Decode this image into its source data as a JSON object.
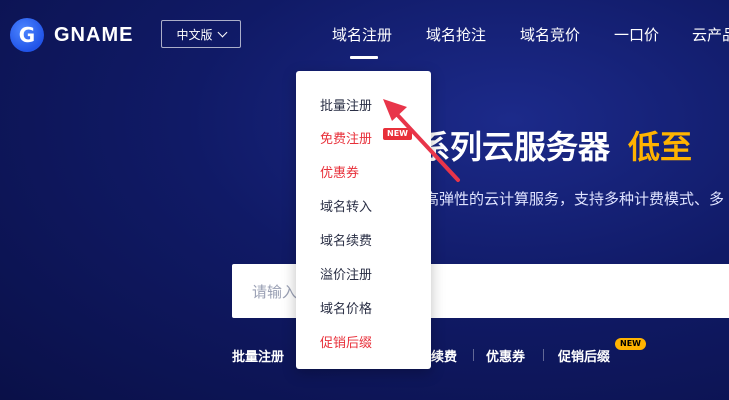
{
  "brand": {
    "logo_glyph": "G",
    "name": "GNAME"
  },
  "language": {
    "label": "中文版"
  },
  "nav": {
    "items": [
      "域名注册",
      "域名抢注",
      "域名竞价",
      "一口价",
      "云产品"
    ]
  },
  "dropdown": {
    "items": [
      {
        "label": "批量注册",
        "highlight": false
      },
      {
        "label": "免费注册",
        "highlight": true,
        "badge": "NEW"
      },
      {
        "label": "优惠券",
        "highlight": true
      },
      {
        "label": "域名转入",
        "highlight": false
      },
      {
        "label": "域名续费",
        "highlight": false
      },
      {
        "label": "溢价注册",
        "highlight": false
      },
      {
        "label": "域名价格",
        "highlight": false
      },
      {
        "label": "促销后缀",
        "highlight": true
      }
    ]
  },
  "hero": {
    "title": "系列云服务器",
    "title_highlight": "低至",
    "subtitle": "高弹性的云计算服务，支持多种计费模式、多"
  },
  "search": {
    "placeholder": "请输入"
  },
  "quick_links": [
    {
      "label": "批量注册"
    },
    {
      "label": "续费"
    },
    {
      "label": "优惠券"
    },
    {
      "label": "促销后缀",
      "badge": "NEW"
    }
  ],
  "colors": {
    "accent": "#ffb300",
    "brand_blue": "#2154e8",
    "danger": "#e8303a",
    "background": "#101a66"
  }
}
